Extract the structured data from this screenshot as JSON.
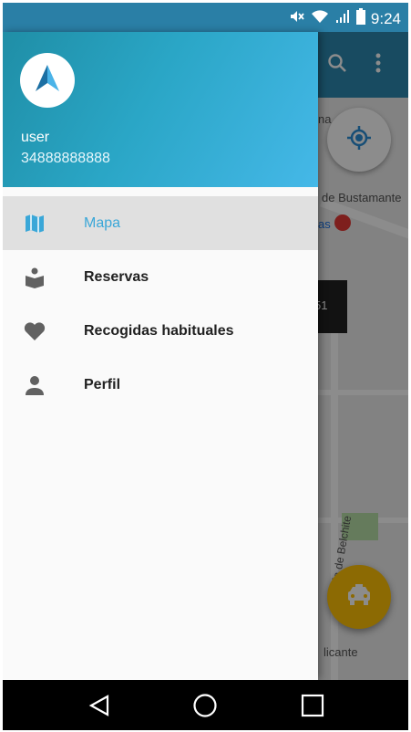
{
  "status_bar": {
    "time": "9:24",
    "icons": [
      "mute-icon",
      "wifi-icon",
      "signal-icon",
      "battery-icon"
    ]
  },
  "toolbar": {
    "icons": [
      "search-icon",
      "more-vert-icon"
    ],
    "color": "#2c89b1"
  },
  "map": {
    "labels": {
      "street_partial_top": "na",
      "street_bustamante": "de Bustamante",
      "street_as": "as",
      "dark_chip": "51",
      "street_belchite": "Batalla de Belchite",
      "street_licante": "licante"
    }
  },
  "drawer": {
    "header": {
      "username": "user",
      "phone": "34888888888",
      "logo": "navigation-arrow-logo"
    },
    "items": [
      {
        "label": "Mapa",
        "icon": "map-icon",
        "active": true
      },
      {
        "label": "Reservas",
        "icon": "book-reader-icon",
        "active": false
      },
      {
        "label": "Recogidas habituales",
        "icon": "heart-icon",
        "active": false
      },
      {
        "label": "Perfil",
        "icon": "person-icon",
        "active": false
      }
    ]
  },
  "fab": {
    "icon": "taxi-icon",
    "color": "#ffc107"
  },
  "navbar": {
    "buttons": [
      "back-icon",
      "home-icon",
      "recents-icon"
    ]
  },
  "colors": {
    "accent": "#3aa7d8",
    "header_gradient_start": "#1f8ea6",
    "header_gradient_end": "#45b8e8"
  }
}
